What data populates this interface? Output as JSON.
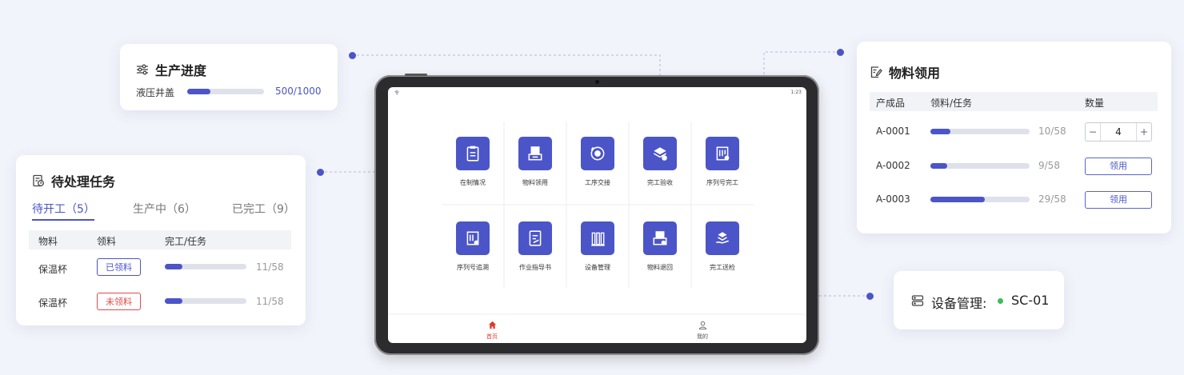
{
  "production": {
    "title": "生产进度",
    "product": "液压井盖",
    "progress_text": "500/1000",
    "progress_fraction": 0.3
  },
  "tasks": {
    "title": "待处理任务",
    "tabs": [
      {
        "label": "待开工（5）"
      },
      {
        "label": "生产中（6）"
      },
      {
        "label": "已完工（9）"
      }
    ],
    "columns": [
      "物料",
      "领料",
      "完工/任务"
    ],
    "rows": [
      {
        "material": "保温杯",
        "status": "已领料",
        "status_color": "#4b55c8",
        "fraction": 0.22,
        "count": "11/58"
      },
      {
        "material": "保温杯",
        "status": "未领料",
        "status_color": "#e04a4a",
        "fraction": 0.22,
        "count": "11/58"
      }
    ]
  },
  "materials": {
    "title": "物料领用",
    "columns": [
      "产成品",
      "领料/任务",
      "数量"
    ],
    "rows": [
      {
        "product": "A-0001",
        "fraction": 0.2,
        "count": "10/58",
        "qty": "4",
        "minus": "−",
        "plus": "+"
      },
      {
        "product": "A-0002",
        "fraction": 0.17,
        "count": "9/58",
        "button": "领用"
      },
      {
        "product": "A-0003",
        "fraction": 0.55,
        "count": "29/58",
        "button": "领用"
      }
    ]
  },
  "device": {
    "label": "设备管理:",
    "code": "SC-01",
    "status_color": "#3dbb5c"
  },
  "tablet": {
    "status_left": "令",
    "status_right": "1:23",
    "apps": [
      {
        "label": "在制情况",
        "icon": "clipboard-icon"
      },
      {
        "label": "物料领用",
        "icon": "document-tray-icon"
      },
      {
        "label": "工序交接",
        "icon": "handover-cycle-icon"
      },
      {
        "label": "完工验收",
        "icon": "layers-check-icon"
      },
      {
        "label": "序列号完工",
        "icon": "barcode-check-icon"
      },
      {
        "label": "序列号追溯",
        "icon": "barcode-trace-icon"
      },
      {
        "label": "作业指导书",
        "icon": "instruction-book-icon"
      },
      {
        "label": "设备管理",
        "icon": "equipment-icon"
      },
      {
        "label": "物料退回",
        "icon": "material-return-icon"
      },
      {
        "label": "完工送检",
        "icon": "inspection-hand-icon"
      }
    ],
    "nav": [
      {
        "label": "首页",
        "icon": "home-icon",
        "active": true
      },
      {
        "label": "我的",
        "icon": "user-icon",
        "active": false
      }
    ],
    "accent": "#4b55c8",
    "nav_active_color": "#e03a2a"
  }
}
